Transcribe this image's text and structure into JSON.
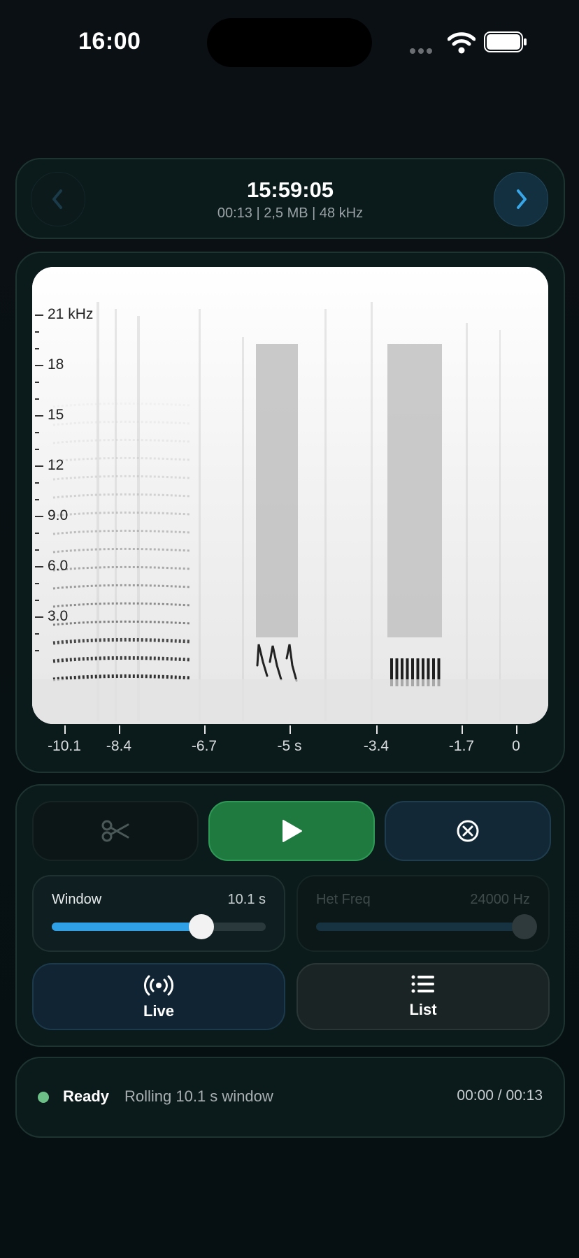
{
  "status_bar": {
    "time": "16:00"
  },
  "recording": {
    "title": "15:59:05",
    "meta": "00:13 | 2,5 MB | 48 kHz"
  },
  "spectrogram": {
    "y_labels": [
      "21 kHz",
      "18",
      "15",
      "12",
      "9.0",
      "6.0",
      "3.0"
    ],
    "x_labels": [
      "-10.1",
      "-8.4",
      "-6.7",
      "-5 s",
      "-3.4",
      "-1.7",
      "0"
    ]
  },
  "controls": {
    "window": {
      "label": "Window",
      "value": "10.1 s",
      "fraction": 0.7
    },
    "het_freq": {
      "label": "Het Freq",
      "value": "24000 Hz",
      "fraction": 1.0
    },
    "live_label": "Live",
    "list_label": "List"
  },
  "status": {
    "state": "Ready",
    "message": "Rolling 10.1 s window",
    "position": "00:00 / 00:13"
  },
  "colors": {
    "accent_blue": "#2f9fe6",
    "play_green": "#1e7a3f",
    "ready_dot": "#6dbf88"
  }
}
